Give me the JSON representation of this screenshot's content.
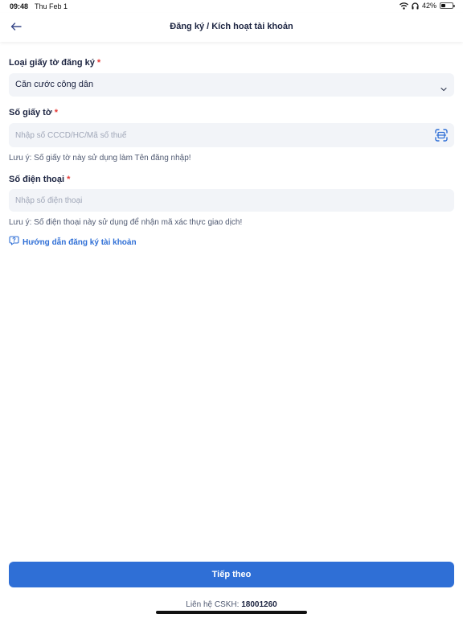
{
  "status_bar": {
    "time": "09:48",
    "date": "Thu Feb 1",
    "battery": "42%",
    "battery_level": 0.42
  },
  "header": {
    "title": "Đăng ký / Kích hoạt tài khoản",
    "back_icon": "arrow-left-icon"
  },
  "form": {
    "document_type": {
      "label": "Loại giấy tờ đăng ký",
      "required_mark": "*",
      "value": "Căn cước công dân",
      "icon": "chevron-down-icon"
    },
    "document_number": {
      "label": "Số giấy tờ",
      "required_mark": "*",
      "value": "",
      "placeholder": "Nhập số CCCD/HC/Mã số thuế",
      "icon": "scan-icon",
      "note": "Lưu ý: Số giấy tờ này sử dụng làm Tên đăng nhập!"
    },
    "phone": {
      "label": "Số điện thoại",
      "required_mark": "*",
      "value": "",
      "placeholder": "Nhập số điện thoại",
      "note": "Lưu ý: Số điện thoại này sử dụng để nhận mã xác thực giao dịch!"
    },
    "guide_link": {
      "label": "Hướng dẫn đăng ký tài khoản",
      "icon": "help-chat-icon"
    }
  },
  "footer": {
    "next_label": "Tiếp theo",
    "support_prefix": "Liên hệ CSKH:",
    "support_phone": "18001260"
  },
  "colors": {
    "accent": "#2f6fd6",
    "required": "#e53935",
    "field_bg": "#f2f4f8",
    "text_dark": "#1b2340"
  }
}
